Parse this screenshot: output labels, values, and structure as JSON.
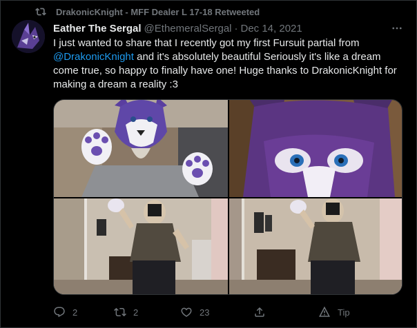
{
  "retweet": {
    "text": "DrakonicKnight - MFF Dealer L 17-18 Retweeted",
    "icon": "retweet-icon"
  },
  "author": {
    "display_name": "Eather The Sergal",
    "handle": "@EthemeralSergal",
    "separator": "·",
    "date": "Dec 14, 2021"
  },
  "tweet": {
    "text_before": "I just wanted to share that I recently got my first Fursuit partial from ",
    "mention": "@DrakonicKnight",
    "text_after": " and it's absolutely beautiful Seriously it's like a dream come true, so happy to finally have one! Huge thanks to DrakonicKnight for making a dream a reality :3"
  },
  "media": [
    {
      "icon": "photo-fursuit-hands"
    },
    {
      "icon": "photo-fursuit-face-closeup"
    },
    {
      "icon": "photo-mirror-selfie-left"
    },
    {
      "icon": "photo-mirror-selfie-right"
    }
  ],
  "actions": {
    "reply_count": "2",
    "retweet_count": "2",
    "like_count": "23",
    "tip_label": "Tip"
  },
  "colors": {
    "background": "#000000",
    "text": "#e7e9ea",
    "secondary": "#71767b",
    "accent": "#1d9bf0",
    "border": "#2f3336"
  }
}
